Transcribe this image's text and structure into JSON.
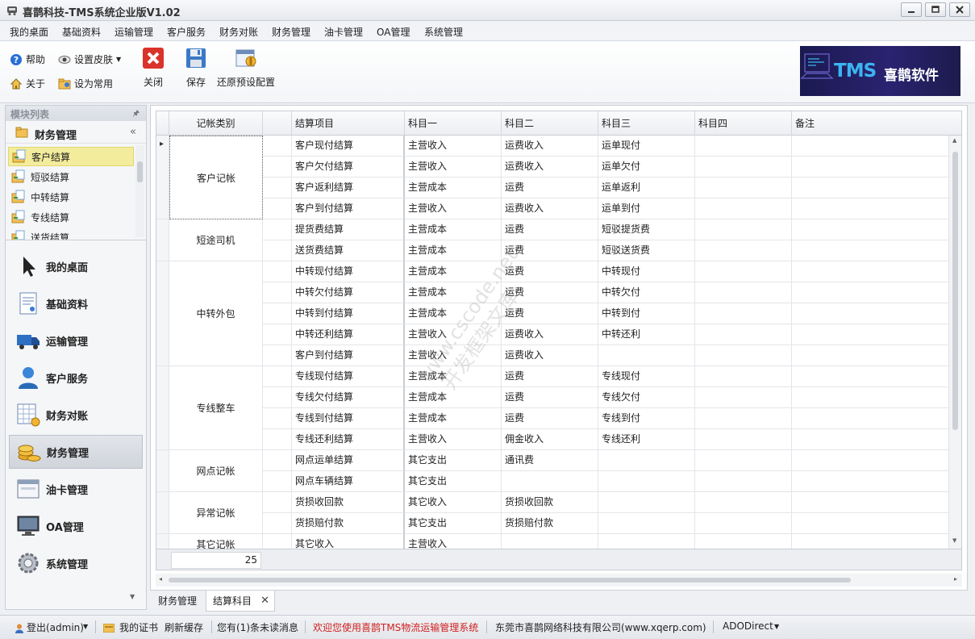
{
  "window": {
    "title": "喜鹊科技-TMS系统企业版V1.02"
  },
  "menu": [
    "我的桌面",
    "基础资料",
    "运输管理",
    "客户服务",
    "财务对账",
    "财务管理",
    "油卡管理",
    "OA管理",
    "系统管理"
  ],
  "toolbar": {
    "help": "帮助",
    "skin": "设置皮肤",
    "about": "关于",
    "set_common": "设为常用",
    "close": "关闭",
    "save": "保存",
    "restore": "还原预设配置"
  },
  "brand": {
    "tms": "TMS",
    "name": "喜鹊软件"
  },
  "left_panel": {
    "header": "模块列表",
    "group": "财务管理",
    "items": [
      "客户结算",
      "短驳结算",
      "中转结算",
      "专线结算",
      "送货结算"
    ],
    "nav": [
      "我的桌面",
      "基础资料",
      "运输管理",
      "客户服务",
      "财务对账",
      "财务管理",
      "油卡管理",
      "OA管理",
      "系统管理"
    ]
  },
  "grid": {
    "columns": [
      "记帐类别",
      "结算项目",
      "科目一",
      "科目二",
      "科目三",
      "科目四",
      "备注"
    ],
    "categories": [
      {
        "label": "客户记帐",
        "rows": 4
      },
      {
        "label": "短途司机",
        "rows": 2
      },
      {
        "label": "中转外包",
        "rows": 5
      },
      {
        "label": "专线整车",
        "rows": 4
      },
      {
        "label": "网点记帐",
        "rows": 2
      },
      {
        "label": "异常记帐",
        "rows": 2
      },
      {
        "label": "其它记帐",
        "rows": 1
      }
    ],
    "rows": [
      [
        "客户现付结算",
        "主营收入",
        "运费收入",
        "运单现付",
        "",
        ""
      ],
      [
        "客户欠付结算",
        "主营收入",
        "运费收入",
        "运单欠付",
        "",
        ""
      ],
      [
        "客户返利结算",
        "主营成本",
        "运费",
        "运单返利",
        "",
        ""
      ],
      [
        "客户到付结算",
        "主营收入",
        "运费收入",
        "运单到付",
        "",
        ""
      ],
      [
        "提货费结算",
        "主营成本",
        "运费",
        "短驳提货费",
        "",
        ""
      ],
      [
        "送货费结算",
        "主营成本",
        "运费",
        "短驳送货费",
        "",
        ""
      ],
      [
        "中转现付结算",
        "主营成本",
        "运费",
        "中转现付",
        "",
        ""
      ],
      [
        "中转欠付结算",
        "主营成本",
        "运费",
        "中转欠付",
        "",
        ""
      ],
      [
        "中转到付结算",
        "主营成本",
        "运费",
        "中转到付",
        "",
        ""
      ],
      [
        "中转还利结算",
        "主营收入",
        "运费收入",
        "中转还利",
        "",
        ""
      ],
      [
        "客户到付结算",
        "主营收入",
        "运费收入",
        "",
        "",
        ""
      ],
      [
        "专线现付结算",
        "主营成本",
        "运费",
        "专线现付",
        "",
        ""
      ],
      [
        "专线欠付结算",
        "主营成本",
        "运费",
        "专线欠付",
        "",
        ""
      ],
      [
        "专线到付结算",
        "主营成本",
        "运费",
        "专线到付",
        "",
        ""
      ],
      [
        "专线还利结算",
        "主营收入",
        "佣金收入",
        "专线还利",
        "",
        ""
      ],
      [
        "网点运单结算",
        "其它支出",
        "通讯费",
        "",
        "",
        ""
      ],
      [
        "网点车辆结算",
        "其它支出",
        "",
        "",
        "",
        ""
      ],
      [
        "货损收回款",
        "其它收入",
        "货损收回款",
        "",
        "",
        ""
      ],
      [
        "货损赔付款",
        "其它支出",
        "货损赔付款",
        "",
        "",
        ""
      ],
      [
        "其它收入",
        "主营收入",
        "",
        "",
        "",
        ""
      ]
    ],
    "footer_count": "25"
  },
  "watermark": [
    "www.cscode.net",
    "开发框架文库"
  ],
  "tabs": [
    "财务管理",
    "结算科目"
  ],
  "status": {
    "logout": "登出(admin)",
    "cert": "我的证书",
    "refresh": "刷新缓存",
    "messages": "您有(1)条未读消息",
    "welcome": "欢迎您使用喜鹊TMS物流运输管理系统",
    "company": "东莞市喜鹊网络科技有限公司(www.xqerp.com)",
    "db": "ADODirect"
  }
}
